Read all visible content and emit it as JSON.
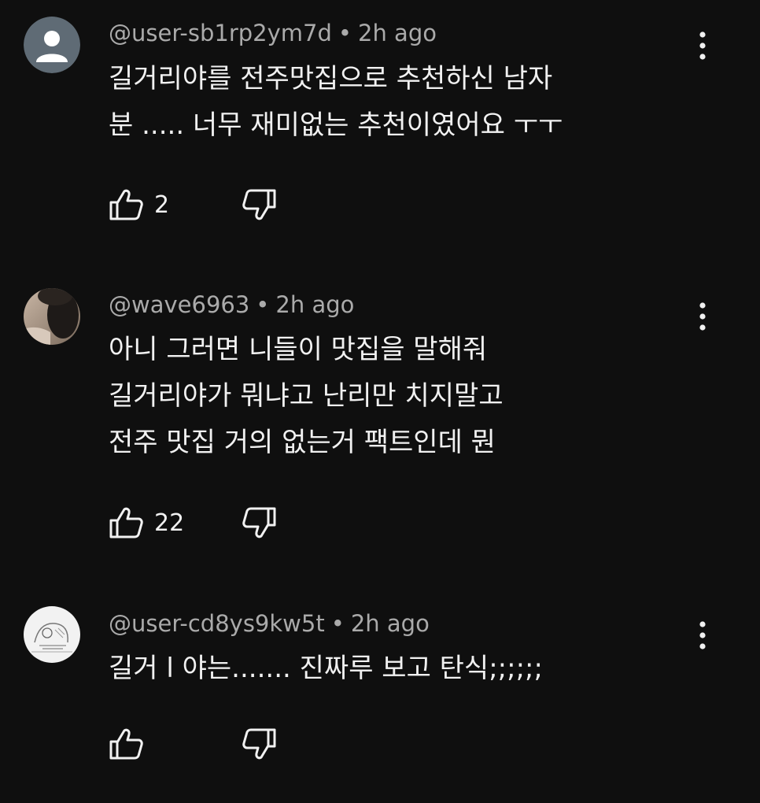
{
  "comments": [
    {
      "author": "@user-sb1rp2ym7d",
      "time": "2h ago",
      "lines": [
        "길거리야를 전주맛집으로 추천하신 남자",
        "분 ..... 너무 재미없는 추천이였어요 ㅜㅜ"
      ],
      "likes": "2",
      "avatar": "default-person"
    },
    {
      "author": "@wave6963",
      "time": "2h ago",
      "lines": [
        "아니 그러면 니들이 맛집을 말해줘",
        "길거리야가 뭐냐고 난리만 치지말고",
        "전주 맛집 거의 없는거 팩트인데 뭔"
      ],
      "likes": "22",
      "avatar": "photo"
    },
    {
      "author": "@user-cd8ys9kw5t",
      "time": "2h ago",
      "lines": [
        "길거 l 야는....... 진짜루 보고 탄식;;;;;;"
      ],
      "likes": "",
      "avatar": "sketch"
    }
  ],
  "separator": "•",
  "icons": {
    "like": "thumbs-up-icon",
    "dislike": "thumbs-down-icon",
    "more": "more-vert-icon"
  },
  "colors": {
    "background": "#0f0f0f",
    "text": "#f1f1f1",
    "meta": "#aaaaaa"
  }
}
